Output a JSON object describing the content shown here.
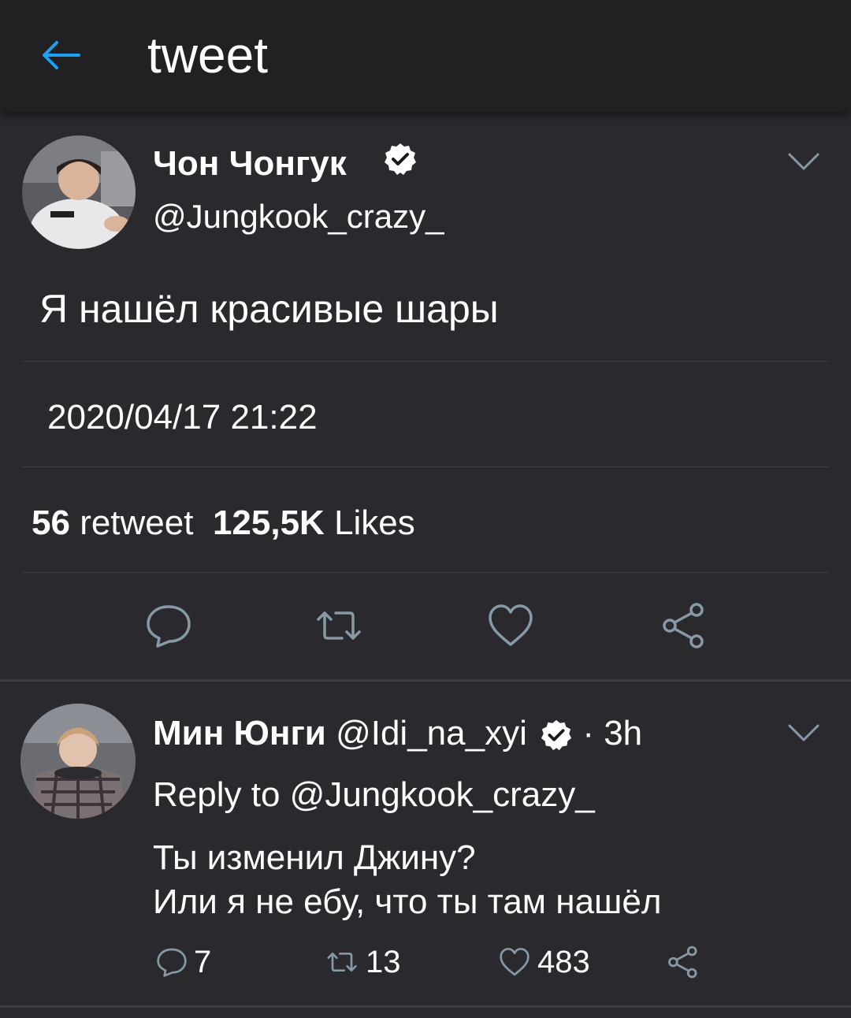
{
  "header": {
    "title": "tweet"
  },
  "main_tweet": {
    "author_name": "Чон Чонгук",
    "handle": "@Jungkook_crazy_",
    "text": "Я нашёл красивые шары",
    "timestamp": "2020/04/17 21:22",
    "retweets_count": "56",
    "retweets_label": "retweet",
    "likes_count": "125,5K",
    "likes_label": "Likes"
  },
  "reply": {
    "author_name": "Мин Юнги",
    "handle": "@Idi_na_xyi",
    "time": "· 3h",
    "reply_to_label": "Reply to",
    "reply_to_handle": "@Jungkook_crazy_",
    "text_line1": "Ты изменил Джину?",
    "text_line2": "Или я не ебу, что ты там нашёл",
    "comments": "7",
    "retweets": "13",
    "likes": "483"
  },
  "icons": {
    "back": "arrow-left-icon",
    "verified": "verified-badge-icon",
    "chevron": "chevron-down-icon",
    "comment": "comment-icon",
    "retweet": "retweet-icon",
    "like": "heart-icon",
    "share": "share-icon"
  },
  "colors": {
    "accent": "#1da1f2",
    "background": "#2a2a2e",
    "header": "#212124",
    "icon_gray": "#8899a6"
  }
}
